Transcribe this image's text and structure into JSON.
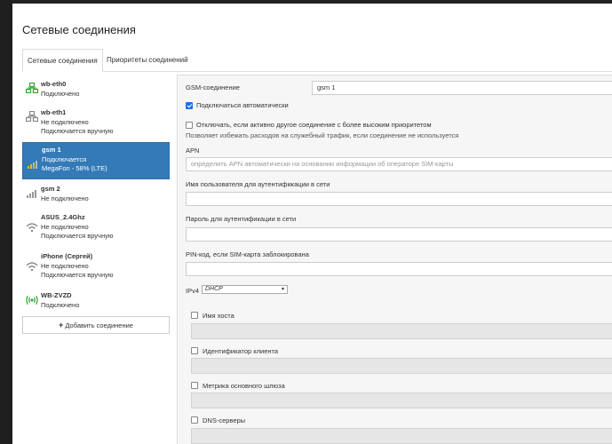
{
  "page": {
    "title": "Сетевые соединения"
  },
  "tabs": [
    "Сетевые соединения",
    "Приоритеты соединений"
  ],
  "connections": [
    {
      "name": "wb-eth0",
      "lines": [
        "Подключено"
      ],
      "icon": "ethernet-connected-icon"
    },
    {
      "name": "wb-eth1",
      "lines": [
        "Не подключено",
        "Подключается вручную"
      ],
      "icon": "ethernet-disconnected-icon"
    },
    {
      "name": "gsm 1",
      "lines": [
        "Подключается",
        "MegaFon - 58% (LTE)"
      ],
      "icon": "cellular-signal-icon"
    },
    {
      "name": "gsm 2",
      "lines": [
        "Не подключено"
      ],
      "icon": "cellular-signal-icon"
    },
    {
      "name": "ASUS_2.4Ghz",
      "lines": [
        "Не подключено",
        "Подключается вручную"
      ],
      "icon": "wifi-icon"
    },
    {
      "name": "iPhone (Сергей)",
      "lines": [
        "Не подключено",
        "Подключается вручную"
      ],
      "icon": "wifi-icon"
    },
    {
      "name": "WB-ZVZD",
      "lines": [
        "Подключено"
      ],
      "icon": "access-point-icon"
    }
  ],
  "add_button": "Добавить соединение",
  "form": {
    "gsm_label": "GSM-соединение",
    "gsm_value": "gsm 1",
    "autoconnect_label": "Подключаться автоматически",
    "disable_label": "Отключать, если активно другое соединение с более высоким приоритетом",
    "disable_help": "Позволяет избежать расходов на служебный трафик, если соединение не используется",
    "apn_label": "APN",
    "apn_placeholder": "определить APN автоматически на основании информации об операторе SIM-карты",
    "username_label": "Имя пользователя для аутентификации в сети",
    "password_label": "Пароль для аутентификации в сети",
    "pin_label": "PIN-код, если SIM-карта заблокирована",
    "ipv4_label": "IPv4",
    "ipv4_value": "DHCP",
    "hostname_label": "Имя хоста",
    "client_id_label": "Идентификатор клиента",
    "metric_label": "Метрика основного шлюза",
    "dns_label": "DNS-серверы"
  },
  "colors": {
    "active": "#337ab7",
    "connected": "#2aa52a",
    "checkbox": "#1a73e8"
  }
}
